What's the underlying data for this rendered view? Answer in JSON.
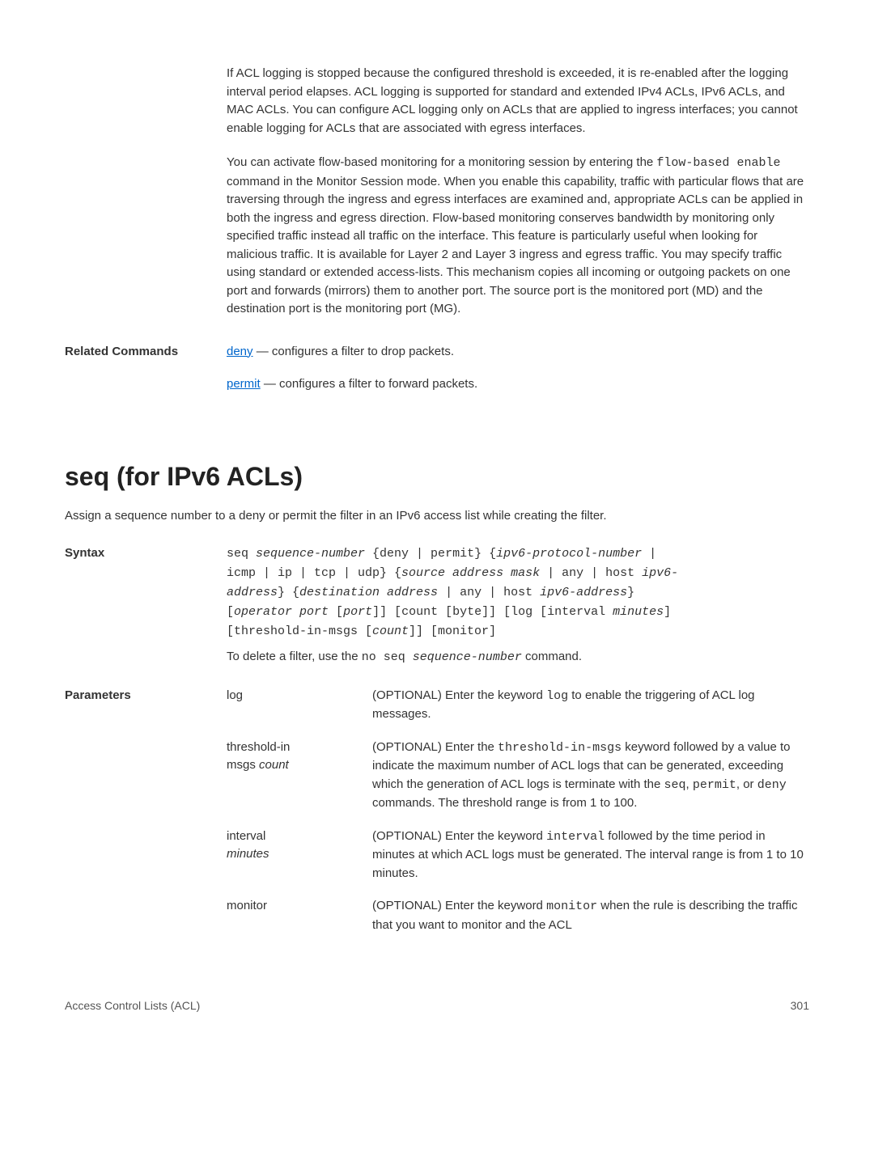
{
  "topBlock": {
    "para1": "If ACL logging is stopped because the configured threshold is exceeded, it is re-enabled after the logging interval period elapses. ACL logging is supported for standard and extended IPv4 ACLs, IPv6 ACLs, and MAC ACLs. You can configure ACL logging only on ACLs that are applied to ingress interfaces; you cannot enable logging for ACLs that are associated with egress interfaces.",
    "para2_before": "You can activate flow-based monitoring for a monitoring session by entering the ",
    "para2_code": "flow-based enable",
    "para2_after": " command in the Monitor Session mode. When you enable this capability, traffic with particular flows that are traversing through the ingress and egress interfaces are examined and, appropriate ACLs can be applied in both the ingress and egress direction. Flow-based monitoring conserves bandwidth by monitoring only specified traffic instead all traffic on the interface. This feature is particularly useful when looking for malicious traffic. It is available for Layer 2 and Layer 3 ingress and egress traffic. You may specify traffic using standard or extended access-lists. This mechanism copies all incoming or outgoing packets on one port and forwards (mirrors) them to another port. The source port is the monitored port (MD) and the destination port is the monitoring port (MG)."
  },
  "related": {
    "label": "Related Commands",
    "deny_link": "deny",
    "deny_text": " — configures a filter to drop packets.",
    "permit_link": "permit",
    "permit_text": " — configures a filter to forward packets."
  },
  "section": {
    "title": "seq (for IPv6 ACLs)",
    "intro": "Assign a sequence number to a deny or permit the filter in an IPv6 access list while creating the filter."
  },
  "syntax": {
    "label": "Syntax",
    "l1_a": "seq ",
    "l1_b": "sequence-number",
    "l1_c": " {deny | permit} {",
    "l1_d": "ipv6-protocol-number",
    "l1_e": " |",
    "l2_a": "icmp | ip | tcp | udp} {",
    "l2_b": "source address mask",
    "l2_c": " | any | host ",
    "l2_d": "ipv6-",
    "l3_a": "address",
    "l3_b": "} {",
    "l3_c": "destination address",
    "l3_d": " | any | host ",
    "l3_e": "ipv6-address",
    "l3_f": "}",
    "l4_a": "[",
    "l4_b": "operator port",
    "l4_c": " [",
    "l4_d": "port",
    "l4_e": "]] [count [byte]] [log [interval ",
    "l4_f": "minutes",
    "l4_g": "]",
    "l5_a": "[threshold-in-msgs [",
    "l5_b": "count",
    "l5_c": "]] [monitor]",
    "note_before": "To delete a filter, use the ",
    "note_code1": "no seq ",
    "note_code2": "sequence-number",
    "note_after": " command."
  },
  "params": {
    "label": "Parameters",
    "log": {
      "name": "log",
      "desc_before": "(OPTIONAL) Enter the keyword ",
      "desc_code": "log",
      "desc_after": " to enable the triggering of ACL log messages."
    },
    "threshold": {
      "name1": "threshold-in",
      "name2_a": "msgs ",
      "name2_b": "count",
      "desc_before": "(OPTIONAL) Enter the ",
      "desc_code1": "threshold-in-msgs",
      "desc_mid": " keyword followed by a value to indicate the maximum number of ACL logs that can be generated, exceeding which the generation of ACL logs is terminate with the ",
      "desc_code2": "seq",
      "desc_code3": "permit",
      "desc_code4": "deny",
      "desc_after": " commands. The threshold range is from 1 to 100."
    },
    "interval": {
      "name1": "interval",
      "name2": "minutes",
      "desc_before": "(OPTIONAL) Enter the keyword ",
      "desc_code": "interval",
      "desc_after": " followed by the time period in minutes at which ACL logs must be generated. The interval range is from 1 to 10 minutes."
    },
    "monitor": {
      "name": "monitor",
      "desc_before": "(OPTIONAL) Enter the keyword ",
      "desc_code": "monitor",
      "desc_after": " when the rule is describing the traffic that you want to monitor and the ACL"
    }
  },
  "footer": {
    "left": "Access Control Lists (ACL)",
    "right": "301"
  }
}
